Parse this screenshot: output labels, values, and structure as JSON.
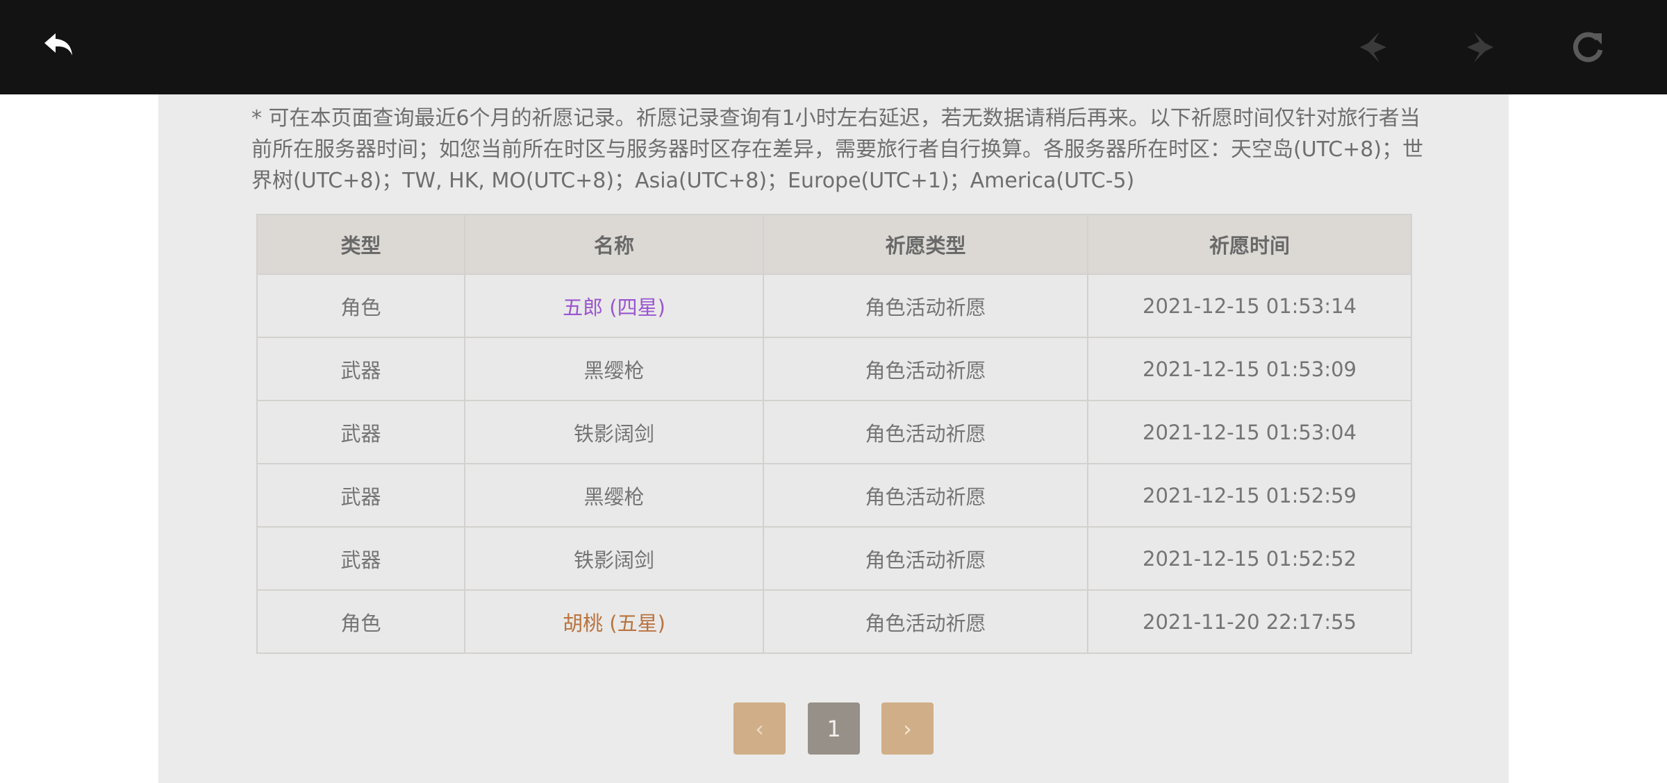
{
  "toolbar": {
    "back_icon": "back-arrow-icon",
    "prev_icon": "diamond-left-arrow-icon",
    "next_icon": "diamond-right-arrow-icon",
    "refresh_icon": "refresh-icon",
    "background": "#131313"
  },
  "notice": {
    "text": "* 可在本页面查询最近6个月的祈愿记录。祈愿记录查询有1小时左右延迟，若无数据请稍后再来。以下祈愿时间仅针对旅行者当前所在服务器时间；如您当前所在时区与服务器时区存在差异，需要旅行者自行换算。各服务器所在时区：天空岛(UTC+8)；世界树(UTC+8)；TW, HK, MO(UTC+8)；Asia(UTC+8)；Europe(UTC+1)；America(UTC-5)"
  },
  "table": {
    "headers": [
      "类型",
      "名称",
      "祈愿类型",
      "祈愿时间"
    ],
    "rows": [
      {
        "type": "角色",
        "name": "五郎 (四星)",
        "wish_type": "角色活动祈愿",
        "time": "2021-12-15 01:53:14",
        "name_color": "#9a55d1"
      },
      {
        "type": "武器",
        "name": "黑缨枪",
        "wish_type": "角色活动祈愿",
        "time": "2021-12-15 01:53:09",
        "name_color": "#747474"
      },
      {
        "type": "武器",
        "name": "铁影阔剑",
        "wish_type": "角色活动祈愿",
        "time": "2021-12-15 01:53:04",
        "name_color": "#747474"
      },
      {
        "type": "武器",
        "name": "黑缨枪",
        "wish_type": "角色活动祈愿",
        "time": "2021-12-15 01:52:59",
        "name_color": "#747474"
      },
      {
        "type": "武器",
        "name": "铁影阔剑",
        "wish_type": "角色活动祈愿",
        "time": "2021-12-15 01:52:52",
        "name_color": "#747474"
      },
      {
        "type": "角色",
        "name": "胡桃 (五星)",
        "wish_type": "角色活动祈愿",
        "time": "2021-11-20 22:17:55",
        "name_color": "#b9733d"
      }
    ]
  },
  "pagination": {
    "prev_label": "‹",
    "current_page": "1",
    "next_label": "›"
  }
}
